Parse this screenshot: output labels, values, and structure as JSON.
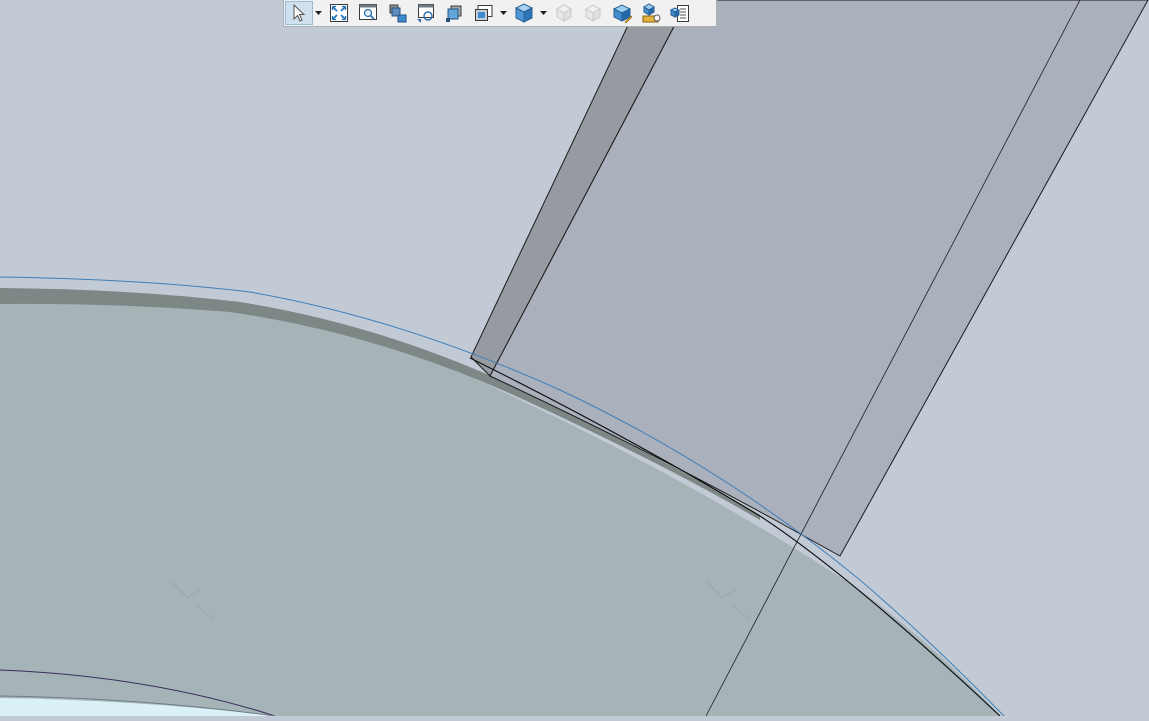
{
  "window": {
    "viewport_background": "#c2cad5"
  },
  "toolbar": {
    "buttons": [
      {
        "name": "select-pointer-icon",
        "active": true,
        "has_dropdown": true
      },
      {
        "name": "zoom-to-fit-icon",
        "active": false,
        "has_dropdown": false
      },
      {
        "name": "zoom-to-area-icon",
        "active": false,
        "has_dropdown": false
      },
      {
        "name": "previous-view-icon",
        "active": false,
        "has_dropdown": false
      },
      {
        "name": "rotate-view-icon",
        "active": false,
        "has_dropdown": false
      },
      {
        "name": "section-view-icon",
        "active": false,
        "has_dropdown": false
      },
      {
        "name": "view-orientation-icon",
        "active": false,
        "has_dropdown": true
      },
      {
        "name": "display-style-icon",
        "active": false,
        "has_dropdown": true
      },
      {
        "name": "hide-show-items-icon",
        "active": false,
        "disabled": true
      },
      {
        "name": "edit-appearance-icon",
        "active": false,
        "disabled": true
      },
      {
        "name": "apply-scene-icon",
        "active": false,
        "has_dropdown": false
      },
      {
        "name": "view-settings-icon",
        "active": false,
        "has_dropdown": false
      },
      {
        "name": "display-pane-icon",
        "active": false,
        "has_dropdown": false
      }
    ]
  },
  "colors": {
    "part_face": "#a5b3b8",
    "part_edge_band": "#7c8685",
    "bar_face": "#aab0bc",
    "bar_side": "#9599a0",
    "sketch_curve": "#3f7fb9",
    "bore_face": "#d9f0f8",
    "inner_curve": "#3b2f5a"
  }
}
